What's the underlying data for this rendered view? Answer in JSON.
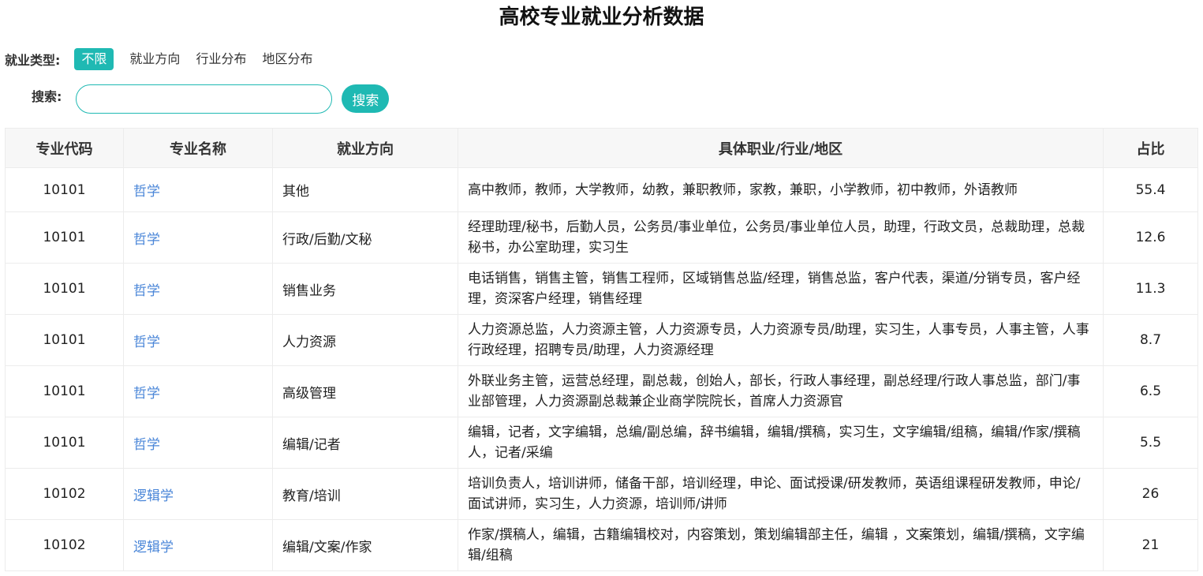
{
  "page": {
    "title": "高校专业就业分析数据"
  },
  "filter": {
    "label": "就业类型:",
    "options": [
      "不限",
      "就业方向",
      "行业分布",
      "地区分布"
    ],
    "selected": "不限"
  },
  "search": {
    "label": "搜索:",
    "placeholder": "",
    "value": "",
    "button_label": "搜索"
  },
  "table": {
    "headers": [
      "专业代码",
      "专业名称",
      "就业方向",
      "具体职业/行业/地区",
      "占比"
    ],
    "rows": [
      [
        "10101",
        "哲学",
        "其他",
        "高中教师，教师，大学教师，幼教，兼职教师，家教，兼职，小学教师，初中教师，外语教师",
        "55.4"
      ],
      [
        "10101",
        "哲学",
        "行政/后勤/文秘",
        "经理助理/秘书，后勤人员，公务员/事业单位，公务员/事业单位人员，助理，行政文员，总裁助理，总裁秘书，办公室助理，实习生",
        "12.6"
      ],
      [
        "10101",
        "哲学",
        "销售业务",
        "电话销售，销售主管，销售工程师，区域销售总监/经理，销售总监，客户代表，渠道/分销专员，客户经理，资深客户经理，销售经理",
        "11.3"
      ],
      [
        "10101",
        "哲学",
        "人力资源",
        "人力资源总监，人力资源主管，人力资源专员，人力资源专员/助理，实习生，人事专员，人事主管，人事行政经理，招聘专员/助理，人力资源经理",
        "8.7"
      ],
      [
        "10101",
        "哲学",
        "高级管理",
        "外联业务主管，运营总经理，副总裁，创始人，部长，行政人事经理，副总经理/行政人事总监，部门/事业部管理，人力资源副总裁兼企业商学院院长，首席人力资源官",
        "6.5"
      ],
      [
        "10101",
        "哲学",
        "编辑/记者",
        "编辑，记者，文字编辑，总编/副总编，辞书编辑，编辑/撰稿，实习生，文字编辑/组稿，编辑/作家/撰稿人，记者/采编",
        "5.5"
      ],
      [
        "10102",
        "逻辑学",
        "教育/培训",
        "培训负责人，培训讲师，储备干部，培训经理，申论、面试授课/研发教师，英语组课程研发教师，申论/面试讲师，实习生，人力资源，培训师/讲师",
        "26"
      ],
      [
        "10102",
        "逻辑学",
        "编辑/文案/作家",
        "作家/撰稿人，编辑，古籍编辑校对，内容策划，策划编辑部主任，编辑 ，文案策划，编辑/撰稿，文字编辑/组稿",
        "21"
      ]
    ]
  },
  "colors": {
    "accent": "#1fb9b3",
    "link": "#4a86d8",
    "header_bg": "#f7f7f7"
  }
}
